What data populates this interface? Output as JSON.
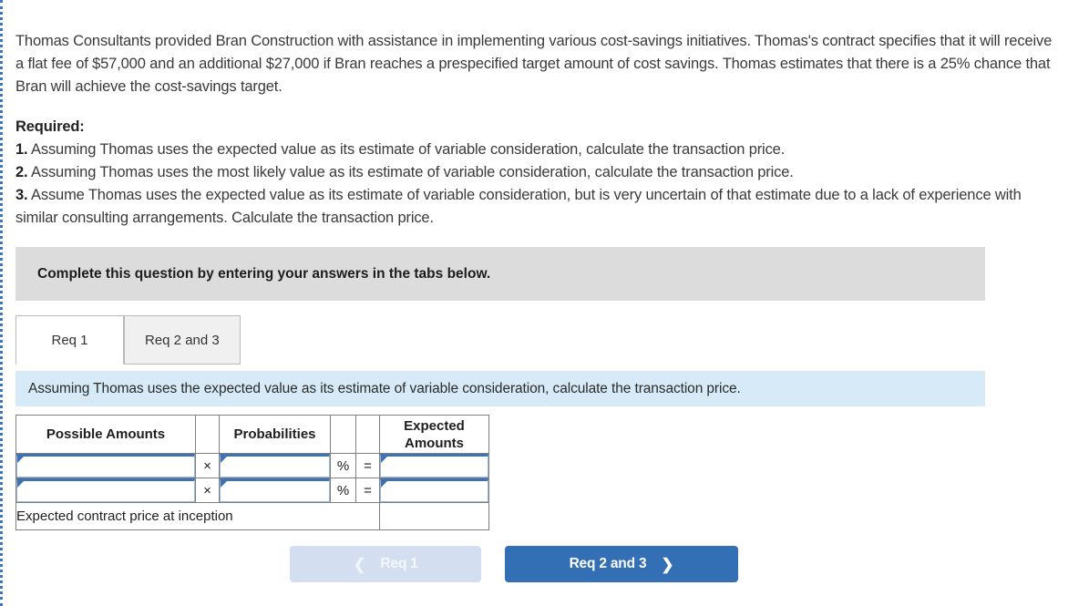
{
  "problem": {
    "text": "Thomas Consultants provided Bran Construction with assistance in implementing various cost-savings initiatives. Thomas's contract specifies that it will receive a flat fee of $57,000 and an additional $27,000 if Bran reaches a prespecified target amount of cost savings. Thomas estimates that there is a 25% chance that Bran will achieve the cost-savings target."
  },
  "required": {
    "heading": "Required:",
    "items": [
      {
        "num": "1.",
        "text": " Assuming Thomas uses the expected value as its estimate of variable consideration, calculate the transaction price."
      },
      {
        "num": "2.",
        "text": " Assuming Thomas uses the most likely value as its estimate of variable consideration, calculate the transaction price."
      },
      {
        "num": "3.",
        "text": " Assume Thomas uses the expected value as its estimate of variable consideration, but is very uncertain of that estimate due to a lack of experience with similar consulting arrangements. Calculate the transaction price."
      }
    ]
  },
  "banner": {
    "text": "Complete this question by entering your answers in the tabs below."
  },
  "tabs": [
    {
      "label": "Req 1",
      "active": true
    },
    {
      "label": "Req 2 and 3",
      "active": false
    }
  ],
  "subinstruction": {
    "text": "Assuming Thomas uses the expected value as its estimate of variable consideration, calculate the transaction price."
  },
  "table": {
    "headers": {
      "possible_amounts": "Possible Amounts",
      "op_blank_1": "",
      "probabilities": "Probabilities",
      "pct_blank": "",
      "eq_blank": "",
      "expected_amounts": "Expected Amounts"
    },
    "rows": [
      {
        "amount": "",
        "op": "×",
        "probability": "",
        "pct": "%",
        "eq": "=",
        "expected": ""
      },
      {
        "amount": "",
        "op": "×",
        "probability": "",
        "pct": "%",
        "eq": "=",
        "expected": ""
      }
    ],
    "total": {
      "label": "Expected contract price at inception",
      "value": ""
    }
  },
  "nav": {
    "prev": {
      "label": "Req 1",
      "icon": "chevron-left",
      "disabled": true
    },
    "next": {
      "label": "Req 2 and 3",
      "icon": "chevron-right",
      "disabled": false
    }
  },
  "colors": {
    "header_blue": "#82b3e0",
    "primary_button": "#336fb4",
    "disabled_button": "#d3dff0",
    "instruction_blue": "#d6eaf7",
    "banner_gray": "#dcdcdc",
    "input_border": "#3f72b0"
  }
}
